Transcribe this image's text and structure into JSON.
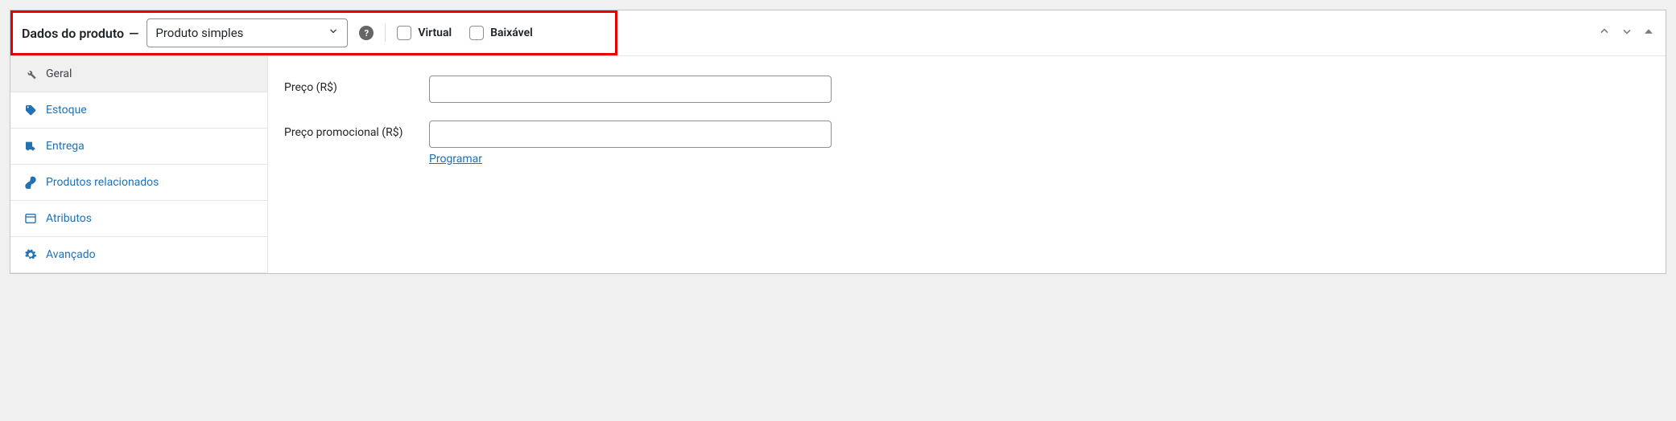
{
  "header": {
    "title": "Dados do produto",
    "dash": "—",
    "product_type": "Produto simples",
    "virtual_label": "Virtual",
    "downloadable_label": "Baixável"
  },
  "tabs": [
    {
      "label": "Geral"
    },
    {
      "label": "Estoque"
    },
    {
      "label": "Entrega"
    },
    {
      "label": "Produtos relacionados"
    },
    {
      "label": "Atributos"
    },
    {
      "label": "Avançado"
    }
  ],
  "form": {
    "price_label": "Preço (R$)",
    "price_value": "",
    "sale_price_label": "Preço promocional (R$)",
    "sale_price_value": "",
    "schedule_label": "Programar"
  }
}
